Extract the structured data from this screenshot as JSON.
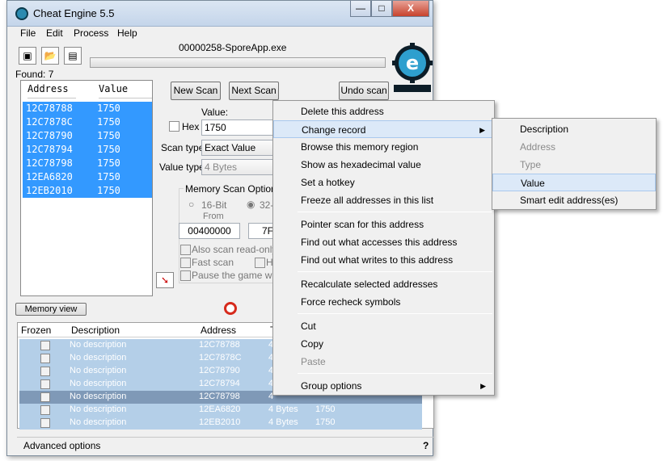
{
  "window": {
    "title": "Cheat Engine 5.5",
    "minimize": "—",
    "maximize": "□",
    "close": "X"
  },
  "menubar": [
    "File",
    "Edit",
    "Process",
    "Help"
  ],
  "process_name": "00000258-SporeApp.exe",
  "found": "Found: 7",
  "logo_caption": "Cheat Engine",
  "addresses": {
    "headers": {
      "address": "Address",
      "value": "Value"
    },
    "rows": [
      {
        "address": "12C78788",
        "value": "1750"
      },
      {
        "address": "12C7878C",
        "value": "1750"
      },
      {
        "address": "12C78790",
        "value": "1750"
      },
      {
        "address": "12C78794",
        "value": "1750"
      },
      {
        "address": "12C78798",
        "value": "1750"
      },
      {
        "address": "12EA6820",
        "value": "1750"
      },
      {
        "address": "12EB2010",
        "value": "1750"
      }
    ]
  },
  "scan": {
    "new_scan": "New Scan",
    "next_scan": "Next Scan",
    "undo_scan": "Undo scan",
    "value_label": "Value:",
    "hex_label": "Hex",
    "value": "1750",
    "scan_type_label": "Scan type",
    "scan_type": "Exact Value",
    "value_type_label": "Value type",
    "value_type": "4 Bytes"
  },
  "options": {
    "title": "Memory Scan Options",
    "bit16": "16-Bit",
    "bit32": "32-",
    "from_label": "From",
    "from_value": "00400000",
    "to_value": "7F",
    "readonly": "Also scan read-only m",
    "fast": "Fast scan",
    "h": "H",
    "pause": "Pause the game whil"
  },
  "memory_view": "Memory view",
  "table": {
    "headers": {
      "frozen": "Frozen",
      "description": "Description",
      "address": "Address",
      "type": "T"
    },
    "rows": [
      {
        "desc": "No description",
        "addr": "12C78788",
        "type": "4",
        "value": ""
      },
      {
        "desc": "No description",
        "addr": "12C7878C",
        "type": "4",
        "value": ""
      },
      {
        "desc": "No description",
        "addr": "12C78790",
        "type": "4",
        "value": ""
      },
      {
        "desc": "No description",
        "addr": "12C78794",
        "type": "4",
        "value": ""
      },
      {
        "desc": "No description",
        "addr": "12C78798",
        "type": "4",
        "value": ""
      },
      {
        "desc": "No description",
        "addr": "12EA6820",
        "type": "4 Bytes",
        "value": "1750"
      },
      {
        "desc": "No description",
        "addr": "12EB2010",
        "type": "4 Bytes",
        "value": "1750"
      }
    ]
  },
  "advanced": "Advanced options",
  "help": "?",
  "context_menu": {
    "delete": "Delete this address",
    "change": "Change record",
    "browse": "Browse this memory region",
    "hex": "Show as hexadecimal value",
    "hotkey": "Set a hotkey",
    "freeze": "Freeze all addresses in this list",
    "pointer": "Pointer scan for this address",
    "accesses": "Find out what accesses this address",
    "writes": "Find out what writes to this address",
    "recalc": "Recalculate selected addresses",
    "recheck": "Force recheck symbols",
    "cut": "Cut",
    "copy": "Copy",
    "paste": "Paste",
    "group": "Group options",
    "submenu_arrow": "▶"
  },
  "submenu": {
    "description": "Description",
    "address": "Address",
    "type": "Type",
    "value": "Value",
    "smart": "Smart edit address(es)"
  }
}
